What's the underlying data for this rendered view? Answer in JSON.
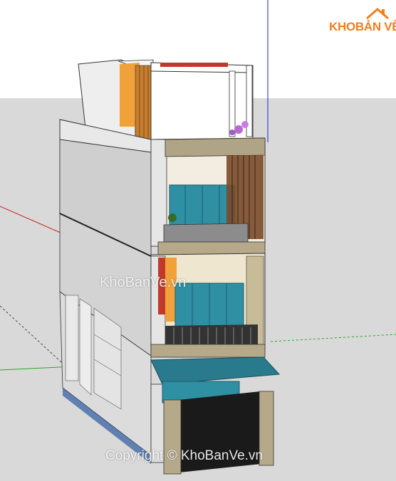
{
  "watermark": {
    "brand_part1": "KHO",
    "brand_part2": "BẢN VẼ",
    "center_text": "KhoBanVe.vn",
    "copyright_text": "Copyright © KhoBanVe.vn"
  },
  "colors": {
    "ground": "#d9d9d9",
    "sky": "#ffffff",
    "wall_light": "#e6e6e6",
    "wall_side": "#c8c8c8",
    "glass": "#2f8fa3",
    "accent_orange": "#f0a13a",
    "accent_red": "#c0392b",
    "stone": "#b5a98a",
    "canopy": "#2a7a8e",
    "garage": "#1a1a1a",
    "axis_red": "#cc2222",
    "axis_green": "#22aa22",
    "axis_blue": "#2222cc",
    "brand": "#f07f1e"
  },
  "icons": [
    "house-roof-icon"
  ]
}
